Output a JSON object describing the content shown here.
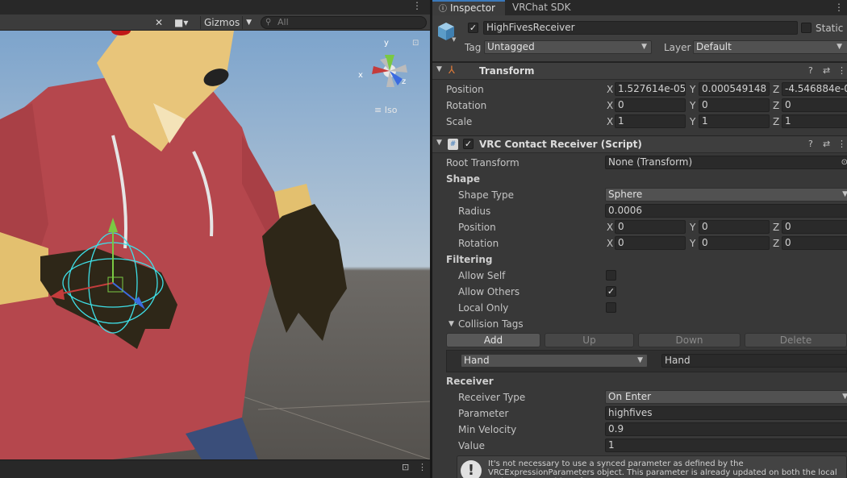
{
  "scene": {
    "gizmos_label": "Gizmos",
    "search_placeholder": "All",
    "axis_x": "x",
    "axis_y": "y",
    "axis_z": "z",
    "projection_label": "Iso"
  },
  "inspector": {
    "tabs": [
      {
        "label": "Inspector"
      },
      {
        "label": "VRChat SDK"
      }
    ],
    "object": {
      "name": "HighFivesReceiver",
      "active": true,
      "static_label": "Static",
      "tag_label": "Tag",
      "tag_value": "Untagged",
      "layer_label": "Layer",
      "layer_value": "Default"
    },
    "transform": {
      "title": "Transform",
      "position_label": "Position",
      "rotation_label": "Rotation",
      "scale_label": "Scale",
      "position": {
        "x": "1.527614e-05",
        "y": "0.000549148",
        "z": "-4.546884e-0"
      },
      "rotation": {
        "x": "0",
        "y": "0",
        "z": "0"
      },
      "scale": {
        "x": "1",
        "y": "1",
        "z": "1"
      }
    },
    "receiver": {
      "title": "VRC Contact Receiver (Script)",
      "root_transform_label": "Root Transform",
      "root_transform_value": "None (Transform)",
      "shape_section": "Shape",
      "shape_type_label": "Shape Type",
      "shape_type_value": "Sphere",
      "radius_label": "Radius",
      "radius_value": "0.0006",
      "position_label": "Position",
      "position": {
        "x": "0",
        "y": "0",
        "z": "0"
      },
      "rotation_label": "Rotation",
      "rotation": {
        "x": "0",
        "y": "0",
        "z": "0"
      },
      "filtering_section": "Filtering",
      "allow_self_label": "Allow Self",
      "allow_self": false,
      "allow_others_label": "Allow Others",
      "allow_others": true,
      "local_only_label": "Local Only",
      "local_only": false,
      "collision_tags_label": "Collision Tags",
      "buttons": {
        "add": "Add",
        "up": "Up",
        "down": "Down",
        "delete": "Delete"
      },
      "tag_dropdown_value": "Hand",
      "tag_text_value": "Hand",
      "receiver_section": "Receiver",
      "receiver_type_label": "Receiver Type",
      "receiver_type_value": "On Enter",
      "parameter_label": "Parameter",
      "parameter_value": "highfives",
      "min_velocity_label": "Min Velocity",
      "min_velocity_value": "0.9",
      "value_label": "Value",
      "value_value": "1",
      "help_text": "It's not necessary to use a synced parameter as defined by the VRCExpressionParameters object.  This parameter is already updated on both the local and remote machine.  If you"
    },
    "axis_labels": {
      "x": "X",
      "y": "Y",
      "z": "Z"
    }
  },
  "colors": {
    "accent": "#3a79bb",
    "axis_x": "#c43c3c",
    "axis_y": "#7ac943",
    "axis_z": "#3b6be0"
  }
}
